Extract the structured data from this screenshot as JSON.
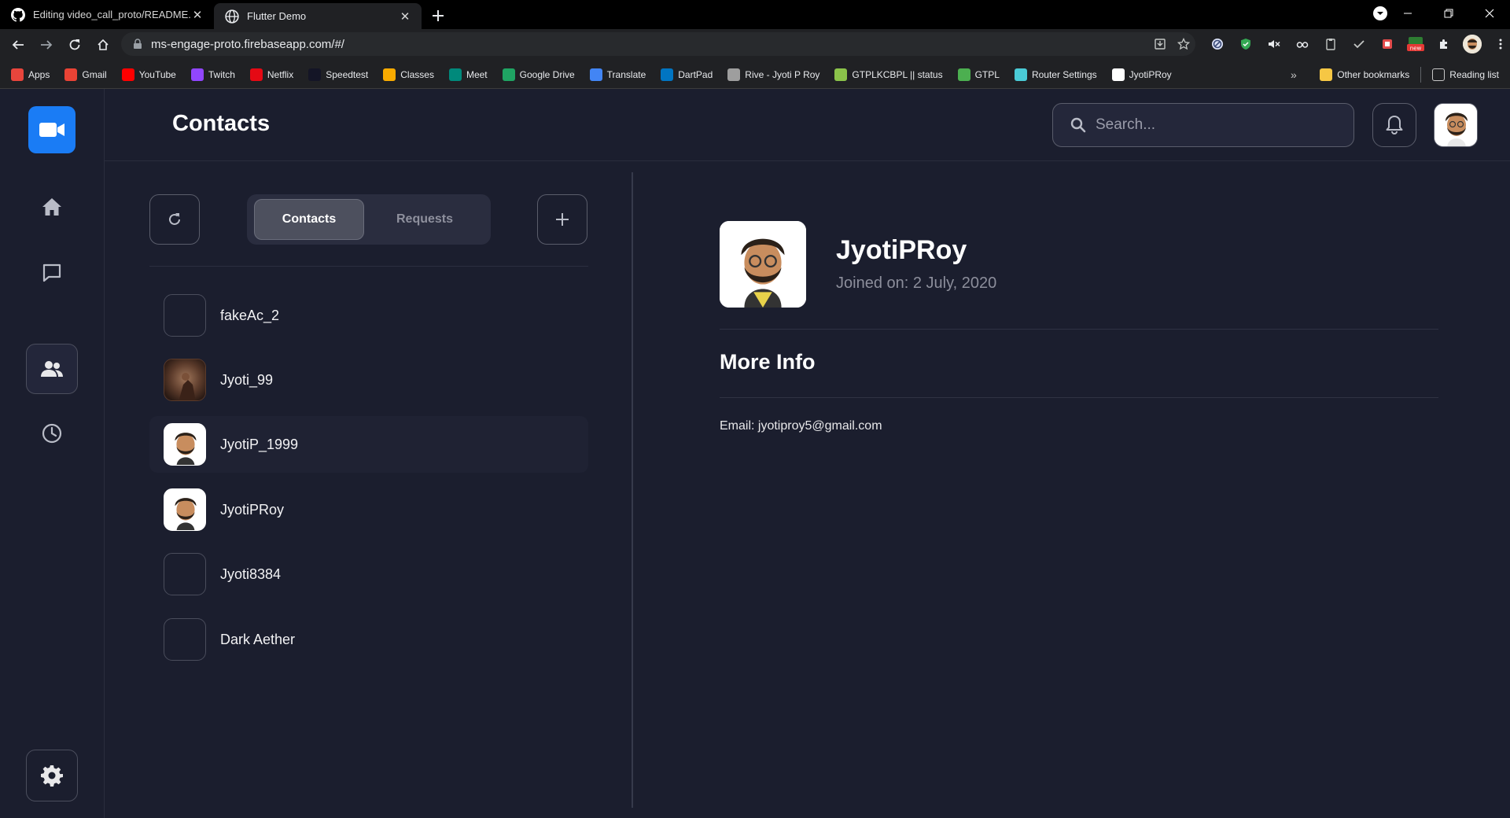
{
  "browser": {
    "tabs": [
      {
        "title": "Editing video_call_proto/README.md",
        "icon": "github-icon",
        "active": false
      },
      {
        "title": "Flutter Demo",
        "icon": "globe-icon",
        "active": true
      }
    ],
    "url": "ms-engage-proto.firebaseapp.com/#/",
    "bookmarks": [
      {
        "label": "Apps",
        "icon": "apps-grid-icon",
        "color": "#e8453c"
      },
      {
        "label": "Gmail",
        "icon": "gmail-icon",
        "color": "#ea4335"
      },
      {
        "label": "YouTube",
        "icon": "youtube-icon",
        "color": "#ff0000"
      },
      {
        "label": "Twitch",
        "icon": "twitch-icon",
        "color": "#9146ff"
      },
      {
        "label": "Netflix",
        "icon": "netflix-icon",
        "color": "#e50914"
      },
      {
        "label": "Speedtest",
        "icon": "speedtest-icon",
        "color": "#141526"
      },
      {
        "label": "Classes",
        "icon": "classroom-icon",
        "color": "#f9ab00"
      },
      {
        "label": "Meet",
        "icon": "meet-icon",
        "color": "#00897b"
      },
      {
        "label": "Google Drive",
        "icon": "drive-icon",
        "color": "#1fa463"
      },
      {
        "label": "Translate",
        "icon": "translate-icon",
        "color": "#4285f4"
      },
      {
        "label": "DartPad",
        "icon": "dartpad-icon",
        "color": "#0175c2"
      },
      {
        "label": "Rive - Jyoti P Roy",
        "icon": "rive-icon",
        "color": "#9e9e9e"
      },
      {
        "label": "GTPLKCBPL || status",
        "icon": "gtpl-status-icon",
        "color": "#8bc34a"
      },
      {
        "label": "GTPL",
        "icon": "gtpl-icon",
        "color": "#4caf50"
      },
      {
        "label": "Router Settings",
        "icon": "router-icon",
        "color": "#4acbd6"
      },
      {
        "label": "JyotiPRoy",
        "icon": "github-icon",
        "color": "#ffffff"
      }
    ],
    "other_bookmarks": "Other bookmarks",
    "reading_list": "Reading list",
    "more_chevron": "»"
  },
  "app": {
    "page_title": "Contacts",
    "search_placeholder": "Search...",
    "tabs": {
      "contacts": "Contacts",
      "requests": "Requests"
    },
    "contacts": [
      {
        "name": "fakeAc_2",
        "avatar": "empty"
      },
      {
        "name": "Jyoti_99",
        "avatar": "photo"
      },
      {
        "name": "JyotiP_1999",
        "avatar": "bitmoji"
      },
      {
        "name": "JyotiPRoy",
        "avatar": "bitmoji"
      },
      {
        "name": "Jyoti8384",
        "avatar": "empty"
      },
      {
        "name": "Dark Aether",
        "avatar": "empty"
      }
    ],
    "detail": {
      "name": "JyotiPRoy",
      "joined": "Joined on: 2 July, 2020",
      "more_info_title": "More Info",
      "email": "Email: jyotiproy5@gmail.com"
    },
    "colors": {
      "accent": "#1a7cf5",
      "background": "#1b1e2e"
    }
  }
}
